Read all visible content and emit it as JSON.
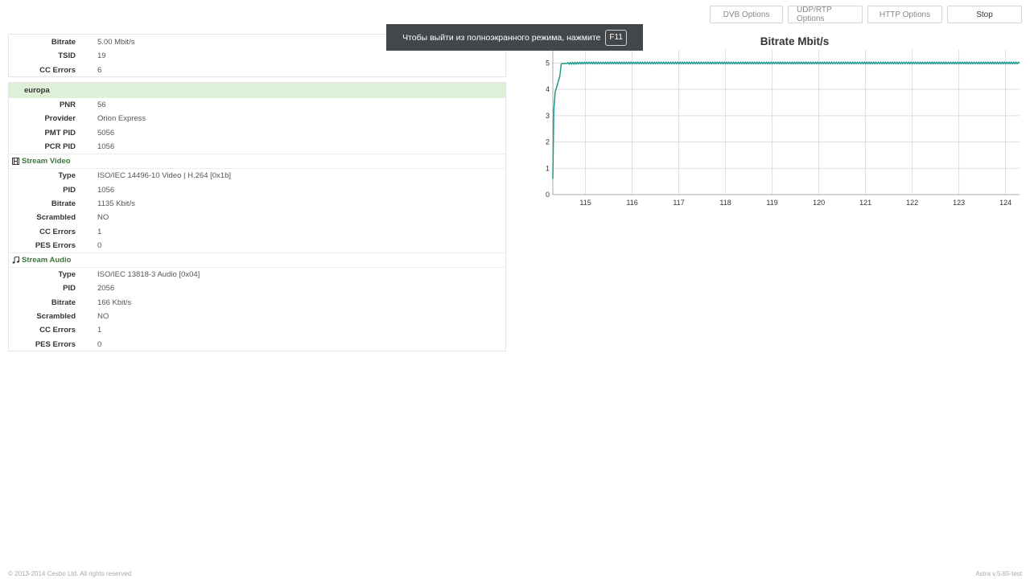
{
  "toolbar": {
    "dvb_label": "DVB Options",
    "udp_label": "UDP/RTP Options",
    "http_label": "HTTP Options",
    "stop_label": "Stop"
  },
  "toast": {
    "message": "Чтобы выйти из полноэкранного режима, нажмите",
    "key": "F11"
  },
  "adapter": {
    "rows": [
      {
        "label": "Bitrate",
        "value": "5.00 Mbit/s"
      },
      {
        "label": "TSID",
        "value": "19"
      },
      {
        "label": "CC Errors",
        "value": "6"
      }
    ]
  },
  "channel": {
    "name": "europa",
    "rows": [
      {
        "label": "PNR",
        "value": "56"
      },
      {
        "label": "Provider",
        "value": "Orion Express"
      },
      {
        "label": "PMT PID",
        "value": "5056"
      },
      {
        "label": "PCR PID",
        "value": "1056"
      }
    ],
    "video": {
      "title": "Stream Video",
      "icon": "film-icon",
      "rows": [
        {
          "label": "Type",
          "value": "ISO/IEC 14496-10 Video | H.264 [0x1b]"
        },
        {
          "label": "PID",
          "value": "1056"
        },
        {
          "label": "Bitrate",
          "value": "1135 Kbit/s"
        },
        {
          "label": "Scrambled",
          "value": "NO"
        },
        {
          "label": "CC Errors",
          "value": "1"
        },
        {
          "label": "PES Errors",
          "value": "0"
        }
      ]
    },
    "audio": {
      "title": "Stream Audio",
      "icon": "music-icon",
      "rows": [
        {
          "label": "Type",
          "value": "ISO/IEC 13818-3 Audio [0x04]"
        },
        {
          "label": "PID",
          "value": "2056"
        },
        {
          "label": "Bitrate",
          "value": "166 Kbit/s"
        },
        {
          "label": "Scrambled",
          "value": "NO"
        },
        {
          "label": "CC Errors",
          "value": "1"
        },
        {
          "label": "PES Errors",
          "value": "0"
        }
      ]
    }
  },
  "chart_data": {
    "type": "line",
    "title": "Bitrate Mbit/s",
    "xlabel": "",
    "ylabel": "",
    "xlim": [
      114.3,
      124.3
    ],
    "ylim": [
      0,
      5.5
    ],
    "x_ticks": [
      115,
      116,
      117,
      118,
      119,
      120,
      121,
      122,
      123,
      124
    ],
    "y_ticks": [
      0,
      1,
      2,
      3,
      4,
      5
    ],
    "grid": true,
    "color": "#1a9a8a",
    "series": [
      {
        "values": [
          [
            114.3,
            0.6
          ],
          [
            114.32,
            3.2
          ],
          [
            114.35,
            3.9
          ],
          [
            114.4,
            4.2
          ],
          [
            114.45,
            4.5
          ],
          [
            114.48,
            4.95
          ],
          [
            114.5,
            4.98
          ],
          [
            115.0,
            5.0
          ],
          [
            116.0,
            5.0
          ],
          [
            117.0,
            5.0
          ],
          [
            118.0,
            5.0
          ],
          [
            119.0,
            5.0
          ],
          [
            120.0,
            5.0
          ],
          [
            121.0,
            5.0
          ],
          [
            122.0,
            5.0
          ],
          [
            123.0,
            5.0
          ],
          [
            124.0,
            5.0
          ],
          [
            124.3,
            5.0
          ]
        ]
      }
    ]
  },
  "footer": {
    "copyright": "© 2013-2014 Cesbo Ltd. All rights reserved.",
    "version": "Astra v.5.65-test"
  }
}
